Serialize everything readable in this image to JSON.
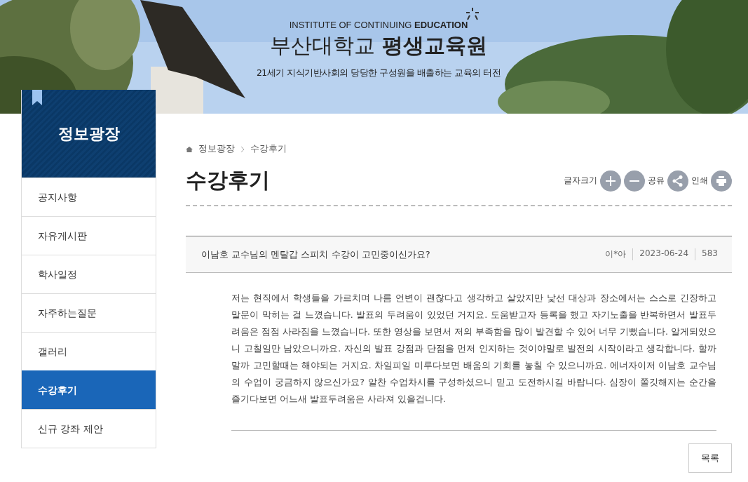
{
  "banner": {
    "kind": "picture",
    "subtitle_en": "INSTITUTE OF CONTINUING",
    "subtitle_en_bold": "EDUCATION",
    "title_light": "부산대학교",
    "title_bold": "평생교육원",
    "tagline": "21세기 지식기반사회의 당당한 구성원을 배출하는 교육의 터전"
  },
  "sidebar": {
    "title": "정보광장",
    "items": [
      {
        "label": "공지사항",
        "selected": false
      },
      {
        "label": "자유게시판",
        "selected": false
      },
      {
        "label": "학사일정",
        "selected": false
      },
      {
        "label": "자주하는질문",
        "selected": false
      },
      {
        "label": "갤러리",
        "selected": false
      },
      {
        "label": "수강후기",
        "selected": true
      },
      {
        "label": "신규 강좌 제안",
        "selected": false
      }
    ]
  },
  "breadcrumb": [
    "정보광장",
    "수강후기"
  ],
  "page_title": "수강후기",
  "tools": {
    "font_size_label": "글자크기",
    "share_label": "공유",
    "print_label": "인쇄"
  },
  "post": {
    "title": "이남호 교수님의 멘탈갑 스피치 수강이 고민중이신가요?",
    "author": "이*아",
    "date": "2023-06-24",
    "views": "583",
    "body": "저는 현직에서 학생들을 가르치며 나름 언변이 괜찮다고 생각하고 살았지만 낯선 대상과 장소에서는 스스로 긴장하고 말문이 막히는 걸 느꼈습니다. 발표의 두려움이 있었던 거지요. 도움받고자 등록을 했고 자기노출을 반복하면서 발표두려움은 점점 사라짐을 느꼈습니다. 또한 영상을 보면서 저의 부족함을 많이 발견할 수 있어 너무 기뻤습니다. 알게되었으니 고칠일만 남았으니까요. 자신의 발표 강점과 단점을 먼저 인지하는 것이야말로 발전의 시작이라고 생각합니다. 할까말까 고민할때는 해야되는 거지요. 차일피일 미루다보면 배움의 기회를 놓칠 수 있으니까요. 에너자이저 이남호 교수님의 수업이 궁금하지 않으신가요? 알찬 수업차시를 구성하셨으니 믿고 도전하시길 바랍니다. 심장이 쫄깃해지는 순간을 즐기다보면 어느새 발표두려움은 사라져 있을겁니다."
  },
  "list_button": "목록"
}
